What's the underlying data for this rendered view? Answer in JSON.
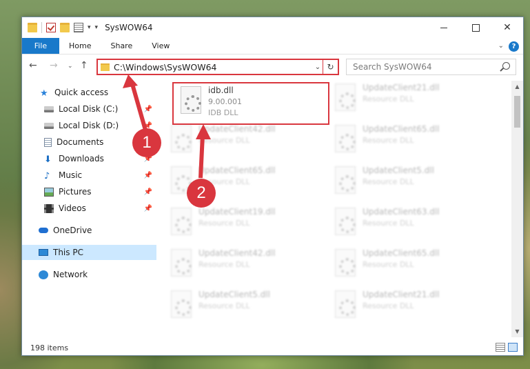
{
  "window": {
    "title": "SysWOW64"
  },
  "ribbon": {
    "tabs": [
      "File",
      "Home",
      "Share",
      "View"
    ],
    "help": "?"
  },
  "address": {
    "path": "C:\\Windows\\SysWOW64",
    "search_placeholder": "Search SysWOW64"
  },
  "nav": {
    "items": [
      {
        "label": "Quick access",
        "icon": "star-icon"
      },
      {
        "label": "Local Disk (C:)",
        "icon": "drive-icon"
      },
      {
        "label": "Local Disk (D:)",
        "icon": "drive-icon"
      },
      {
        "label": "Documents",
        "icon": "documents-icon"
      },
      {
        "label": "Downloads",
        "icon": "download-icon"
      },
      {
        "label": "Music",
        "icon": "music-icon"
      },
      {
        "label": "Pictures",
        "icon": "pictures-icon"
      },
      {
        "label": "Videos",
        "icon": "videos-icon"
      },
      {
        "label": "OneDrive",
        "icon": "cloud-icon"
      },
      {
        "label": "This PC",
        "icon": "computer-icon"
      },
      {
        "label": "Network",
        "icon": "network-icon"
      }
    ]
  },
  "files": {
    "featured": {
      "name": "idb.dll",
      "version": "9.00.001",
      "desc": "IDB DLL"
    },
    "left_column": [
      {
        "name": "UpdateClient42.dll",
        "desc": "Resource DLL"
      },
      {
        "name": "UpdateClient65.dll",
        "desc": "Resource DLL"
      },
      {
        "name": "UpdateClient19.dll",
        "desc": "Resource DLL"
      },
      {
        "name": "UpdateClient42.dll",
        "desc": "Resource DLL"
      },
      {
        "name": "UpdateClient5.dll",
        "desc": "Resource DLL"
      }
    ],
    "right_column": [
      {
        "name": "UpdateClient21.dll",
        "desc": "Resource DLL"
      },
      {
        "name": "UpdateClient65.dll",
        "desc": "Resource DLL"
      },
      {
        "name": "UpdateClient5.dll",
        "desc": "Resource DLL"
      },
      {
        "name": "UpdateClient63.dll",
        "desc": "Resource DLL"
      },
      {
        "name": "UpdateClient65.dll",
        "desc": "Resource DLL"
      },
      {
        "name": "UpdateClient21.dll",
        "desc": "Resource DLL"
      }
    ]
  },
  "status": {
    "count": "198 items"
  },
  "annotations": {
    "step1": "1",
    "step2": "2",
    "accent": "#d9363e"
  }
}
